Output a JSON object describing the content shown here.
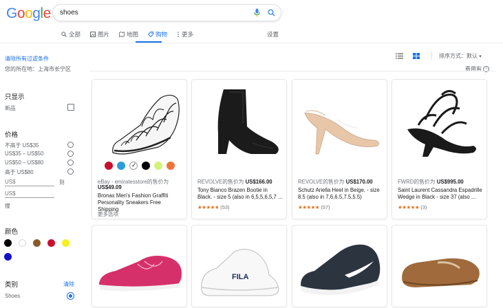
{
  "header": {
    "logo_letters": [
      {
        "ch": "G",
        "color": "#4285f4"
      },
      {
        "ch": "o",
        "color": "#ea4335"
      },
      {
        "ch": "o",
        "color": "#fbbc05"
      },
      {
        "ch": "g",
        "color": "#4285f4"
      },
      {
        "ch": "l",
        "color": "#34a853"
      },
      {
        "ch": "e",
        "color": "#ea4335"
      }
    ],
    "search_query": "shoes",
    "tabs": [
      {
        "label": "全部",
        "icon": "search-icon"
      },
      {
        "label": "图片",
        "icon": "image-icon"
      },
      {
        "label": "地图",
        "icon": "map-icon"
      },
      {
        "label": "购物",
        "icon": "tag-icon",
        "active": true
      },
      {
        "label": "更多",
        "icon": "more-icon"
      }
    ],
    "settings": "设置"
  },
  "filters": {
    "clear_all": "清除所有过滤条件",
    "location": "您的所在地：上海市长宁区",
    "show_only_title": "只显示",
    "new_label": "新品",
    "price_title": "价格",
    "price_options": [
      "不高于 US$35",
      "US$35 – US$50",
      "US$50 – US$80",
      "高于 US$80"
    ],
    "price_min_placeholder": "US$",
    "price_to": "到",
    "price_max_placeholder": "US$",
    "price_go": "搜",
    "color_title": "颜色",
    "colors": [
      "#000000",
      "#ffffff",
      "#8b5a2b",
      "#c8102e",
      "#f5f020",
      "#1010c8"
    ],
    "category_title": "类别",
    "category_clear": "清除",
    "category_item": "Shoes"
  },
  "toolbar": {
    "sort_label": "排序方式：默认",
    "help_label": "费用有"
  },
  "products": [
    {
      "seller_prefix": "eBay - emiratesstore的售价为",
      "price": "US$49.09",
      "title": "Bronax Men's Fashion Graffiti Personality Sneakers Free Shipping",
      "more": "更多选项",
      "swatches": [
        "#c8102e",
        "#2d9bd8",
        "#ffffff",
        "#000000",
        "#d4f27a",
        "#f0743a"
      ]
    },
    {
      "seller_prefix": "REVOLVE的售价为",
      "price": "US$166.00",
      "title": "Tony Bianco Brazen Bootie in Black. - size 5 (also in 6,5,5,6,5,7 ...",
      "stars": "★★★★★",
      "reviews": "(53)"
    },
    {
      "seller_prefix": "REVOLVE的售价为",
      "price": "US$170.00",
      "title": "Schutz Ariella Heel in Beige. - size 8.5 (also in 7,6,6.5,7.5,5.5)",
      "stars": "★★★★★",
      "reviews": "(57)"
    },
    {
      "seller_prefix": "FWRD的售价为",
      "price": "US$995.00",
      "title": "Saint Laurent Cassandra Espadrille Wedge in Black - size 37 (also ...",
      "stars": "★★★★★",
      "reviews": "(3)"
    }
  ]
}
